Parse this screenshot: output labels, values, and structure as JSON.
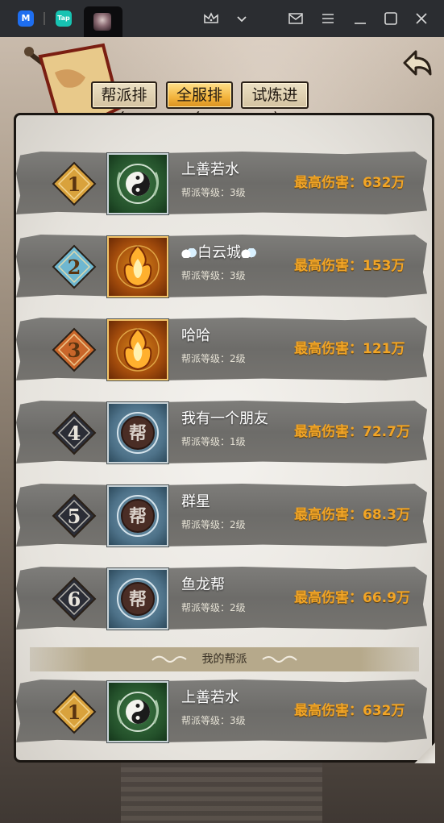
{
  "tabs": [
    "帮派排名",
    "全服排名",
    "试炼进度"
  ],
  "active_tab": 1,
  "level_label": "帮派等级：",
  "damage_label": "最高伤害：",
  "rows": [
    {
      "rank": "1",
      "name": "上善若水",
      "level": "3级",
      "damage": "632万",
      "emblem": "taiji-emblem"
    },
    {
      "rank": "2",
      "name": "白云城",
      "level": "3级",
      "damage": "153万",
      "emblem": "flame-emblem"
    },
    {
      "rank": "3",
      "name": "哈哈",
      "level": "2级",
      "damage": "121万",
      "emblem": "flame-emblem"
    },
    {
      "rank": "4",
      "name": "我有一个朋友",
      "level": "1级",
      "damage": "72.7万",
      "emblem": "bang-emblem"
    },
    {
      "rank": "5",
      "name": "群星",
      "level": "2级",
      "damage": "68.3万",
      "emblem": "bang-emblem"
    },
    {
      "rank": "6",
      "name": "鱼龙帮",
      "level": "2级",
      "damage": "66.9万",
      "emblem": "bang-emblem"
    }
  ],
  "emblem_char": "帮",
  "my_guild_label": "我的帮派",
  "my_guild": {
    "rank": "1",
    "name": "上善若水",
    "level": "3级",
    "damage": "632万",
    "emblem": "taiji-emblem"
  },
  "colors": {
    "gold": "#f2a526",
    "rank1": "#d9a23c",
    "rank2": "#6fb7d0",
    "rank3": "#c9662a",
    "rank_default": "#2b2d36"
  }
}
